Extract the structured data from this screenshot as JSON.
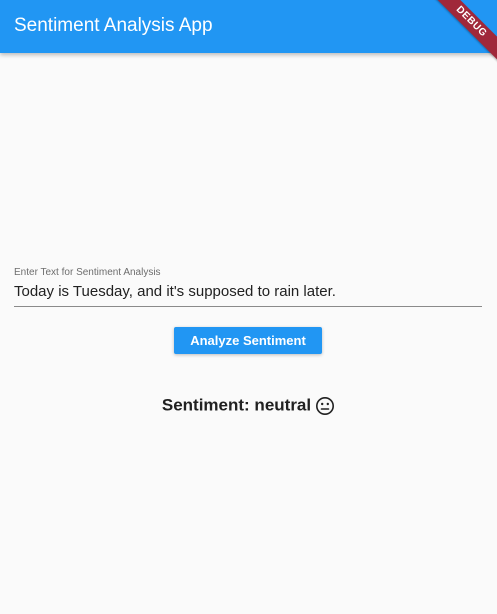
{
  "app_bar": {
    "title": "Sentiment Analysis App",
    "color": "#2196f3"
  },
  "debug_banner": {
    "label": "DEBUG",
    "color": "#a0283a"
  },
  "sentiment_field": {
    "label": "Enter Text for Sentiment Analysis",
    "value": "Today is Tuesday, and it's supposed to rain later."
  },
  "analyze_button": {
    "label": "Analyze Sentiment"
  },
  "result": {
    "text": "Sentiment: neutral",
    "icon": "neutral-face-icon"
  }
}
